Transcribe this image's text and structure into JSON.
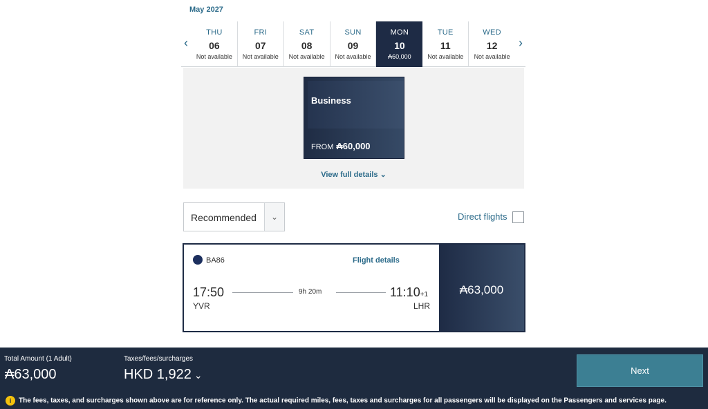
{
  "calendar": {
    "month": "May 2027",
    "days": [
      {
        "dow": "THU",
        "num": "06",
        "status": "Not available"
      },
      {
        "dow": "FRI",
        "num": "07",
        "status": "Not available"
      },
      {
        "dow": "SAT",
        "num": "08",
        "status": "Not available"
      },
      {
        "dow": "SUN",
        "num": "09",
        "status": "Not available"
      },
      {
        "dow": "MON",
        "num": "10",
        "status": "₳60,000",
        "selected": true
      },
      {
        "dow": "TUE",
        "num": "11",
        "status": "Not available"
      },
      {
        "dow": "WED",
        "num": "12",
        "status": "Not available"
      }
    ],
    "prev_icon": "chevron-left-icon",
    "next_icon": "chevron-right-icon"
  },
  "cabin": {
    "name": "Business",
    "from_label": "FROM",
    "from_price": "₳60,000",
    "view_details": "View full details"
  },
  "filters": {
    "sort_value": "Recommended",
    "direct_label": "Direct flights",
    "direct_checked": false
  },
  "flight": {
    "number": "BA86",
    "details_link": "Flight details",
    "dep_time": "17:50",
    "dep_code": "YVR",
    "arr_time": "11:10",
    "arr_plus": "+1",
    "arr_code": "LHR",
    "duration": "9h 20m",
    "price": "₳63,000"
  },
  "footer": {
    "total_label": "Total Amount (1 Adult)",
    "total_value": "₳63,000",
    "tax_label": "Taxes/fees/surcharges",
    "tax_value": "HKD 1,922",
    "next_label": "Next",
    "info_icon": "i",
    "notice": "The fees, taxes, and surcharges shown above are for reference only. The actual required miles, fees, taxes and surcharges for all passengers will be displayed on the Passengers and services page."
  },
  "colors": {
    "accent": "#2c6b8a",
    "navy": "#1e2b45",
    "next_button": "#3c7f93",
    "info": "#f4c20d"
  }
}
